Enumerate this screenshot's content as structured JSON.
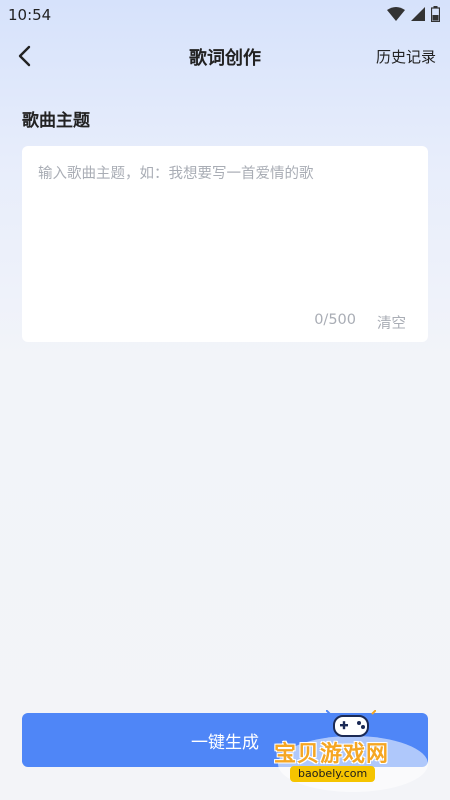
{
  "status_bar": {
    "time": "10:54",
    "icons": [
      "wifi-icon",
      "signal-icon",
      "battery-icon"
    ]
  },
  "nav": {
    "back_icon": "chevron-left-icon",
    "title": "歌词创作",
    "history_label": "历史记录"
  },
  "form": {
    "section_title": "歌曲主题",
    "input_value": "",
    "input_placeholder": "输入歌曲主题，如：我想要写一首爱情的歌",
    "char_count": "0/500",
    "clear_label": "清空"
  },
  "actions": {
    "generate_label": "一键生成"
  },
  "watermark": {
    "text": "宝贝游戏网",
    "domain": "baobely.com"
  },
  "colors": {
    "primary": "#4f86f7",
    "placeholder": "#a9adb5",
    "watermark": "#f5a623"
  }
}
